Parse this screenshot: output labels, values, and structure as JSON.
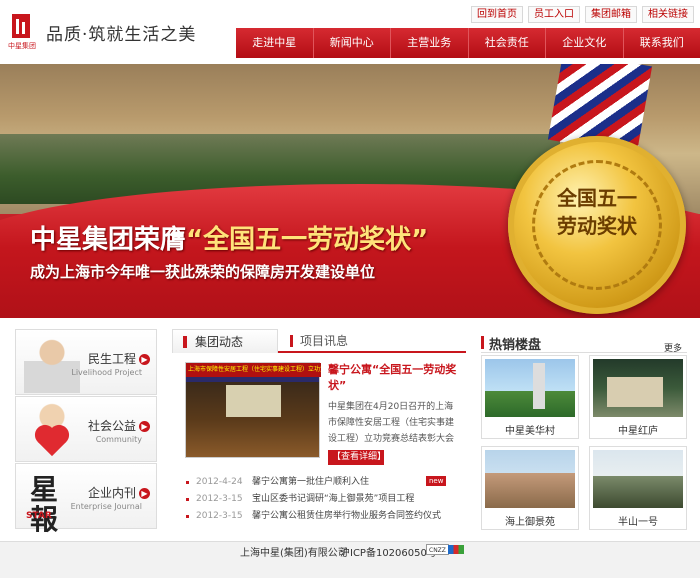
{
  "brand": {
    "slogan": "品质·筑就生活之美",
    "logo_caption": "中星集团"
  },
  "toplinks": [
    "回到首页",
    "员工入口",
    "集团邮箱",
    "相关链接"
  ],
  "nav": [
    "走进中星",
    "新闻中心",
    "主营业务",
    "社会责任",
    "企业文化",
    "联系我们"
  ],
  "banner": {
    "headline_prefix": "中星集团荣膺",
    "headline_quote": "“全国五一劳动奖状”",
    "subline": "成为上海市今年唯一获此殊荣的保障房开发建设单位",
    "medal_text_line1": "全国五一",
    "medal_text_line2": "劳动奖状"
  },
  "left_cards": [
    {
      "title": "民生工程",
      "subtitle": "Livelihood Project"
    },
    {
      "title": "社会公益",
      "subtitle": "Community"
    },
    {
      "title": "企业内刊",
      "subtitle": "Enterprise Journal",
      "logo_text": "星報",
      "logo_sub": "STAR"
    }
  ],
  "news": {
    "tabs": [
      "集团动态",
      "项目讯息"
    ],
    "headline": "馨宁公寓“全国五一劳动奖状”",
    "body": "中星集团在4月20日召开的上海市保障性安居工程（住宅实事建设工程）立功竞赛总结表彰大会上...",
    "more_label": "【查看详细】",
    "image_banner": "上海市保障性安居工程（住宅实事建设工程）立功竞赛总结表彰大会",
    "items": [
      {
        "date": "2012-4-24",
        "title": "馨宁公寓第一批住户顺利入住",
        "badge": "new"
      },
      {
        "date": "2012-3-15",
        "title": "宝山区委书记调研“海上御景苑”项目工程",
        "badge": ""
      },
      {
        "date": "2012-3-15",
        "title": "馨宁公寓公租赁住房举行物业服务合同签约仪式",
        "badge": ""
      }
    ]
  },
  "hot": {
    "title": "热销楼盘",
    "more": "更多",
    "properties": [
      "中星美华村",
      "中星红庐",
      "海上御景苑",
      "半山一号"
    ]
  },
  "footer": {
    "copyright": "上海中星(集团)有限公司",
    "icp": "沪ICP备10206050号",
    "badge": "CNZZ"
  },
  "colors": {
    "brand_red": "#c8161d",
    "gold": "#f2c440"
  }
}
